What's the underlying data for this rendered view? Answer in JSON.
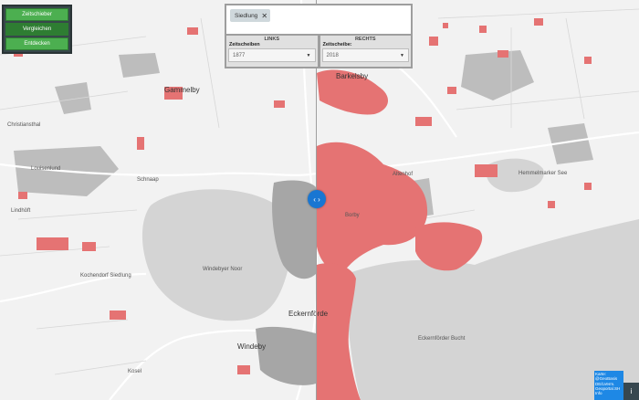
{
  "nav": {
    "items": [
      {
        "label": "Zeitschieber",
        "active": true
      },
      {
        "label": "Vergleichen",
        "active": false
      },
      {
        "label": "Entdecken",
        "active": true
      }
    ]
  },
  "search": {
    "chip_label": "Siedlung",
    "chip_close": "✕"
  },
  "compare": {
    "left": {
      "heading": "LINKS",
      "field_label": "Zeitscheiben",
      "value": "1877"
    },
    "right": {
      "heading": "RECHTS",
      "field_label": "Zeitscheibe:",
      "value": "2018"
    }
  },
  "swipe_icon": "‹ ›",
  "map_labels": {
    "barkelsby": "Barkelsby",
    "gammelby": "Gammelby",
    "eckernfoerde": "Eckernförde",
    "windeby": "Windeby",
    "windebyer_noor": "Windebyer Noor",
    "kochendorf": "Kochendorf Siedlung",
    "eckernfoerder_bucht": "Eckernförder Bucht",
    "hemmelmarker_see": "Hemmelmarker See",
    "altenhof": "Altenhof",
    "louisenlund": "Louisenlund",
    "schnaap": "Schnaap",
    "lindhoeft": "Lindhöft",
    "borby": "Borby",
    "kosel": "Kosel",
    "christiansthal": "Christiansthal"
  },
  "attribution": {
    "line1": "Karte: @GeoBasis",
    "line2": "DE/LVerm.",
    "line3": "Geoportal.SH",
    "line4": "Info"
  },
  "info_icon": "i",
  "colors": {
    "settlement": "#e57373",
    "water": "#cfcfcf",
    "nav_active": "#4caf50",
    "swipe": "#1976d2",
    "attribution": "#1e88e5"
  }
}
